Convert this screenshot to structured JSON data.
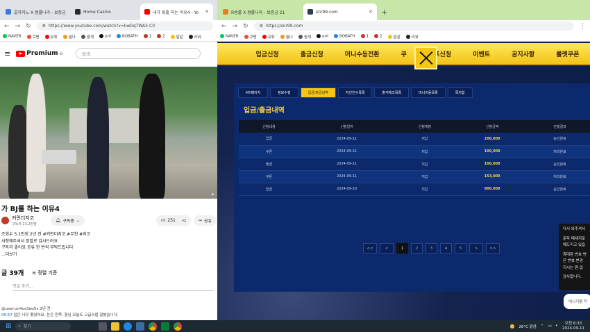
{
  "left_window": {
    "tabs": [
      {
        "label": "콜카지노 X 썸롤나라 - 보증금",
        "color": "#3a7bd5"
      },
      {
        "label": "Home Casino",
        "color": "#2b2b2b"
      },
      {
        "label": "내가 퇴출 하는 이유4 - Yo",
        "color": "#ff0000",
        "active": true
      }
    ],
    "url": "https://www.youtube.com/watch?v=kwDqTWA3-C0",
    "bookmarks": [
      "NAVER",
      "쿠팡",
      "유튜",
      "쉴나",
      "중계",
      "pnf",
      "BOBATH",
      "1",
      "2",
      "말같",
      "리뷰"
    ]
  },
  "youtube": {
    "logo": "Premium",
    "logo_region": "KR",
    "search_placeholder": "검색",
    "video_title": "가 BJ를 하는 이유4",
    "channel_name": "커먼더지코",
    "channel_subs": "구독자 23.2만명",
    "subscribe_label": "구독중",
    "like_count": "251",
    "share_label": "공유",
    "desc_lines": [
      "조회수 5.1만회 2년 전 #커먼더지코 #무친 #지코",
      "사청해주셔서 정말로 감사드려요",
      "구독과 좋아요 공유 한 번씩 부탁드립니다",
      "...더보기"
    ],
    "desc_tags": "#커먼더지코 #무친 #지코",
    "comment_count": "글 39개",
    "sort_label": "정렬 기준",
    "comment_placeholder": "댓글 추가...",
    "comment_user": "@user-un4us3ws5v",
    "comment_age": "2년 전",
    "comment_time": "05:57",
    "comment_text": "입은 너무 좋았어요. 눈은 왼쪽. 형님 오늘도 고급스럽 잘봤습니다."
  },
  "right_window": {
    "tabs": [
      {
        "label": "R썸롤 X 썸롤나라 - 보증금 21",
        "color": "#e67e22"
      },
      {
        "label": "snr99.com",
        "color": "#2c3e50",
        "active": true
      }
    ],
    "url": "https://snr99.com",
    "bookmarks": [
      "NAVER",
      "쿠팡",
      "유튜",
      "쉴나",
      "중계",
      "pnf",
      "BOBATH",
      "1",
      "2",
      "말같",
      "리뷰"
    ]
  },
  "site": {
    "gnb": [
      "입금신청",
      "출금신청",
      "머니수동전환",
      "쿠",
      "콤프신청",
      "이벤트",
      "공지사항",
      "룰렛쿠폰"
    ],
    "subtabs": [
      "MY페이지",
      "정보수정",
      "입금/출금내역",
      "지인친구목록",
      "출석체크목록",
      "머니이동목록",
      "쪽지함"
    ],
    "active_subtab": 2,
    "page_title": "입금/출금내역",
    "table": {
      "headers": [
        "신청내용",
        "신청일자",
        "신청계정",
        "신청금액",
        "진행결과"
      ],
      "rows": [
        [
          "입금",
          "2024-09-11",
          "지갑",
          "200,000",
          "승인완료"
        ],
        [
          "쿠폰",
          "2024-09-11",
          "지갑",
          "100,000",
          "처리완료"
        ],
        [
          "출금",
          "2024-09-11",
          "지갑",
          "100,000",
          "승인완료"
        ],
        [
          "쿠폰",
          "2024-09-11",
          "지갑",
          "153,000",
          "처리완료"
        ],
        [
          "입금",
          "2024-09-10",
          "지갑",
          "900,000",
          "승인완료"
        ]
      ]
    },
    "pager": [
      "<<",
      "<",
      "1",
      "2",
      "3",
      "4",
      "5",
      ">",
      ">>"
    ],
    "active_page": "1",
    "chat_lines": [
      "다시 와주셔서",
      "",
      "문자 메세지로",
      "해드리고 있습",
      "",
      "휴대폰 번호 변",
      "은 번호 변경",
      "지시는 원 없",
      "",
      "감사합니다."
    ],
    "chat_input": "메시지를 작"
  },
  "taskbar": {
    "search_label": "찾기",
    "weather": "26°C 맑음",
    "time": "오전 6:33",
    "date": "2024-09-11"
  }
}
